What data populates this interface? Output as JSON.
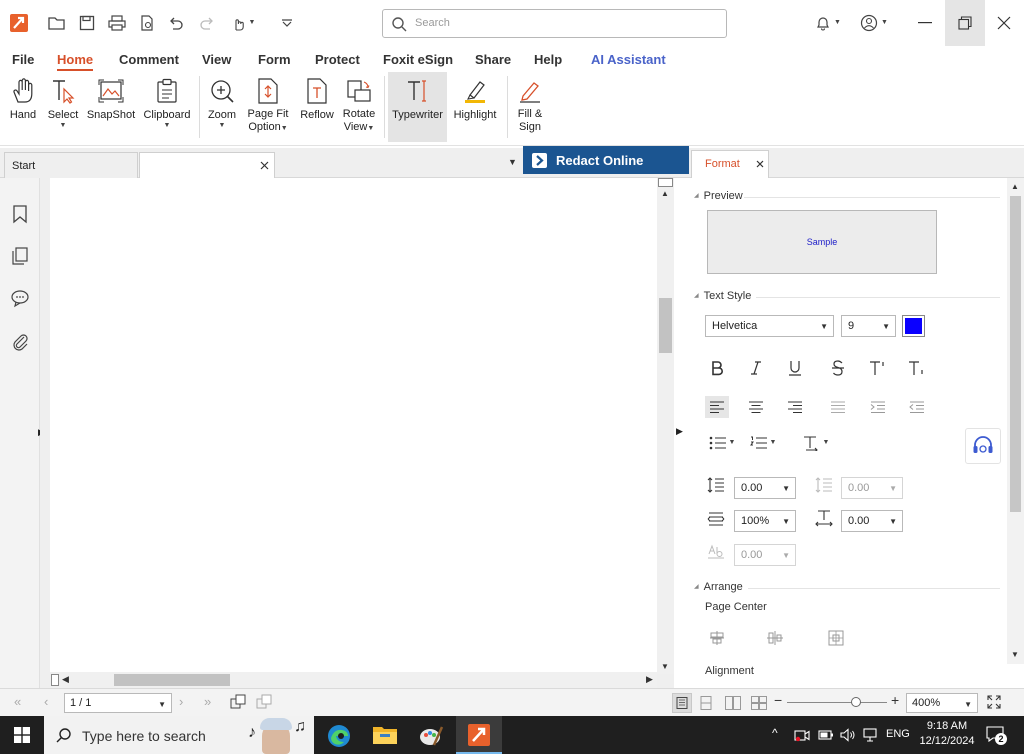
{
  "app": {
    "search_placeholder": "Search"
  },
  "menu": {
    "tabs": [
      "File",
      "Home",
      "Comment",
      "View",
      "Form",
      "Protect",
      "Foxit eSign",
      "Share",
      "Help",
      "AI Assistant"
    ],
    "active": "Home"
  },
  "ribbon": {
    "hand": "Hand",
    "select": "Select",
    "snapshot": "SnapShot",
    "clipboard": "Clipboard",
    "zoom": "Zoom",
    "page_fit_1": "Page Fit",
    "page_fit_2": "Option",
    "reflow": "Reflow",
    "rotate_1": "Rotate",
    "rotate_2": "View",
    "typewriter": "Typewriter",
    "highlight": "Highlight",
    "fill_sign_1": "Fill &",
    "fill_sign_2": "Sign"
  },
  "doc_tabs": {
    "start": "Start",
    "current": ""
  },
  "redact": {
    "label": "Redact Online"
  },
  "panel": {
    "tab": "Format",
    "preview_section": "Preview",
    "preview_sample": "Sample",
    "text_style_section": "Text Style",
    "font": "Helvetica",
    "font_size": "9",
    "font_color": "#0a00ff",
    "line_spacing": "0.00",
    "line_spacing_disabled": "0.00",
    "char_scale": "100%",
    "char_spacing": "0.00",
    "baseline": "0.00",
    "arrange_section": "Arrange",
    "page_center": "Page Center",
    "alignment": "Alignment"
  },
  "status": {
    "page": "1 / 1",
    "zoom": "400%"
  },
  "taskbar": {
    "search_placeholder": "Type here to search",
    "time": "9:18 AM",
    "date": "12/12/2024",
    "lang": "ENG",
    "notifications": "2"
  },
  "colors": {
    "accent": "#d7502a",
    "redact_bg": "#1b5591",
    "ai": "#4a63c9"
  }
}
